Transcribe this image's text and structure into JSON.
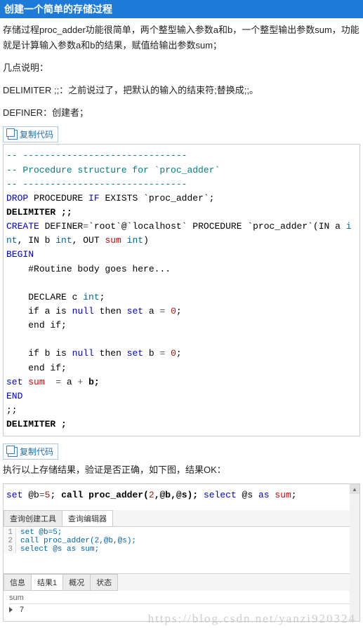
{
  "header": {
    "title": "创建一个简单的存储过程"
  },
  "intro": {
    "p1": "存储过程proc_adder功能很简单，两个整型输入参数a和b，一个整型输出参数sum，功能就是计算输入参数a和b的结果，赋值给输出参数sum；",
    "p2": "几点说明：",
    "p3": "DELIMITER ;;：之前说过了，把默认的输入的结束符;替换成;;。",
    "p4": "DEFINER：创建者；"
  },
  "copy": {
    "label": "复制代码"
  },
  "code1": {
    "l1": "-- ------------------------------",
    "l2": "-- Procedure structure for `proc_adder`",
    "l3": "-- ------------------------------",
    "l4a": "DROP",
    "l4b": " PROCEDURE ",
    "l4c": "IF",
    "l4d": " EXISTS `proc_adder`;",
    "l5": "DELIMITER ;;",
    "l6a": "CREATE",
    "l6b": " DEFINER",
    "l6c": "=",
    "l6d": "`root`",
    "l6e": "@",
    "l6f": "`localhost`",
    "l6g": " PROCEDURE `proc_adder`(IN a ",
    "l6h": "int",
    "l6i": ", IN b ",
    "l6j": "int",
    "l6k": ", OUT ",
    "l6l": "sum",
    "l6m": " ",
    "l6n": "int",
    "l6o": ")",
    "l7": "BEGIN",
    "l8": "    #Routine body goes here...",
    "l9": "",
    "l10a": "    DECLARE c ",
    "l10b": "int",
    "l10c": ";",
    "l11a": "    if a is ",
    "l11b": "null",
    "l11c": " then ",
    "l11d": "set",
    "l11e": " a ",
    "l11f": "=",
    "l11g": " ",
    "l11h": "0",
    "l11i": ";",
    "l12a": "    end if",
    "l12b": ";",
    "l13": "",
    "l14a": "    if b is ",
    "l14b": "null",
    "l14c": " then ",
    "l14d": "set",
    "l14e": " b ",
    "l14f": "=",
    "l14g": " ",
    "l14h": "0",
    "l14i": ";",
    "l15a": "    end if",
    "l15b": ";",
    "l16a": "set",
    "l16b": " ",
    "l16c": "sum",
    "l16d": "  ",
    "l16e": "=",
    "l16f": " a ",
    "l16g": "+",
    "l16h": " b;",
    "l17": "END",
    "l18": ";;",
    "l19": "DELIMITER ;"
  },
  "mid_text": "执行以上存储结果，验证是否正确，如下图，结果OK：",
  "code2": {
    "l1a": "set",
    "l1b": " @b",
    "l1c": "=",
    "l1d": "5",
    "l1e": ";",
    "l2a": "call proc_adder(",
    "l2b": "2",
    "l2c": ",@b,@s);",
    "l3a": "select",
    "l3b": " @s ",
    "l3c": "as",
    "l3d": " ",
    "l3e": "sum",
    "l3f": ";"
  },
  "editor": {
    "top_tabs": [
      "查询创建工具",
      "查询编辑器"
    ],
    "lines": [
      "set @b=5;",
      "call proc_adder(2,@b,@s);",
      "select @s as sum;"
    ],
    "line_nums": [
      "1",
      "2",
      "3"
    ],
    "bottom_tabs": [
      "信息",
      "结果1",
      "概况",
      "状态"
    ],
    "result_col": "sum",
    "result_val": "7"
  },
  "scroll": {
    "up": "▴",
    "down": "▾"
  },
  "watermark": "https://blog.csdn.net/yanzi920324"
}
